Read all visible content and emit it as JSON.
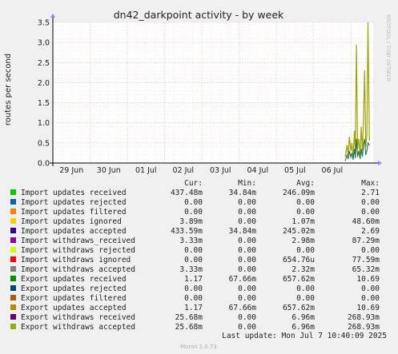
{
  "chart_data": {
    "type": "line",
    "title": "dn42_darkpoint activity - by week",
    "ylabel": "routes per second",
    "xlabel": "",
    "side_label": "RRDTOOL / TOBI OETIKER",
    "ylim": [
      0,
      3.5
    ],
    "y_ticks": [
      "0.0",
      "0.5",
      "1.0",
      "1.5",
      "2.0",
      "2.5",
      "3.0",
      "3.5"
    ],
    "x_ticks": [
      "29 Jun",
      "30 Jun",
      "01 Jul",
      "02 Jul",
      "03 Jul",
      "04 Jul",
      "05 Jul",
      "06 Jul"
    ],
    "x_range_days": [
      0,
      8.6
    ],
    "grid": true,
    "legend_headers": {
      "cur": "Cur:",
      "min": "Min:",
      "avg": "Avg:",
      "max": "Max:"
    },
    "series": [
      {
        "name": "Import updates received",
        "color": "#00cc00",
        "cur": "437.48m",
        "min": "34.84m",
        "avg": "246.09m",
        "max": "2.71"
      },
      {
        "name": "Import updates rejected",
        "color": "#0066b3",
        "cur": "0.00",
        "min": "0.00",
        "avg": "0.00",
        "max": "0.00"
      },
      {
        "name": "Import updates filtered",
        "color": "#ff8000",
        "cur": "0.00",
        "min": "0.00",
        "avg": "0.00",
        "max": "0.00"
      },
      {
        "name": "Import updates ignored",
        "color": "#ffcc00",
        "cur": "3.89m",
        "min": "0.00",
        "avg": "1.07m",
        "max": "48.60m"
      },
      {
        "name": "Import updates accepted",
        "color": "#330099",
        "cur": "433.59m",
        "min": "34.84m",
        "avg": "245.02m",
        "max": "2.69"
      },
      {
        "name": "Import withdraws_received",
        "color": "#990099",
        "cur": "3.33m",
        "min": "0.00",
        "avg": "2.98m",
        "max": "87.29m"
      },
      {
        "name": "Import withdraws rejected",
        "color": "#ccff00",
        "cur": "0.00",
        "min": "0.00",
        "avg": "0.00",
        "max": "0.00"
      },
      {
        "name": "Import withdraws ignored",
        "color": "#ff0000",
        "cur": "0.00",
        "min": "0.00",
        "avg": "654.76u",
        "max": "77.59m"
      },
      {
        "name": "Import withdraws accepted",
        "color": "#808080",
        "cur": "3.33m",
        "min": "0.00",
        "avg": "2.32m",
        "max": "65.32m"
      },
      {
        "name": "Export updates received",
        "color": "#008f00",
        "cur": "1.17",
        "min": "67.66m",
        "avg": "657.62m",
        "max": "10.69"
      },
      {
        "name": "Export updates rejected",
        "color": "#00487d",
        "cur": "0.00",
        "min": "0.00",
        "avg": "0.00",
        "max": "0.00"
      },
      {
        "name": "Export updates filtered",
        "color": "#b35a00",
        "cur": "0.00",
        "min": "0.00",
        "avg": "0.00",
        "max": "0.00"
      },
      {
        "name": "Export updates accepted",
        "color": "#b38f00",
        "cur": "1.17",
        "min": "67.66m",
        "avg": "657.62m",
        "max": "10.69"
      },
      {
        "name": "Export withdraws received",
        "color": "#6b006b",
        "cur": "25.68m",
        "min": "0.00",
        "avg": "6.96m",
        "max": "268.93m"
      },
      {
        "name": "Export withdraws accepted",
        "color": "#8fb300",
        "cur": "25.68m",
        "min": "0.00",
        "avg": "6.96m",
        "max": "268.93m"
      }
    ],
    "trace": {
      "x_days": [
        7.85,
        7.9,
        7.93,
        7.96,
        8.0,
        8.03,
        8.06,
        8.1,
        8.12,
        8.15,
        8.18,
        8.21,
        8.25,
        8.28,
        8.31,
        8.34,
        8.37,
        8.4,
        8.43,
        8.46,
        8.5
      ],
      "export_updates": [
        0.15,
        0.45,
        0.2,
        0.65,
        0.3,
        0.5,
        0.15,
        0.8,
        0.25,
        2.95,
        0.35,
        0.6,
        0.2,
        0.9,
        0.3,
        1.1,
        2.3,
        0.4,
        0.7,
        3.5,
        0.55
      ],
      "import_updates": [
        0.05,
        0.2,
        0.1,
        0.3,
        0.15,
        0.25,
        0.08,
        0.35,
        0.12,
        0.6,
        0.15,
        0.3,
        0.1,
        0.35,
        0.15,
        0.45,
        0.6,
        0.2,
        0.3,
        0.5,
        0.44
      ]
    },
    "last_update": "Last update: Mon Jul  7 10:40:09 2025",
    "footer": "Munin 2.0.73"
  }
}
